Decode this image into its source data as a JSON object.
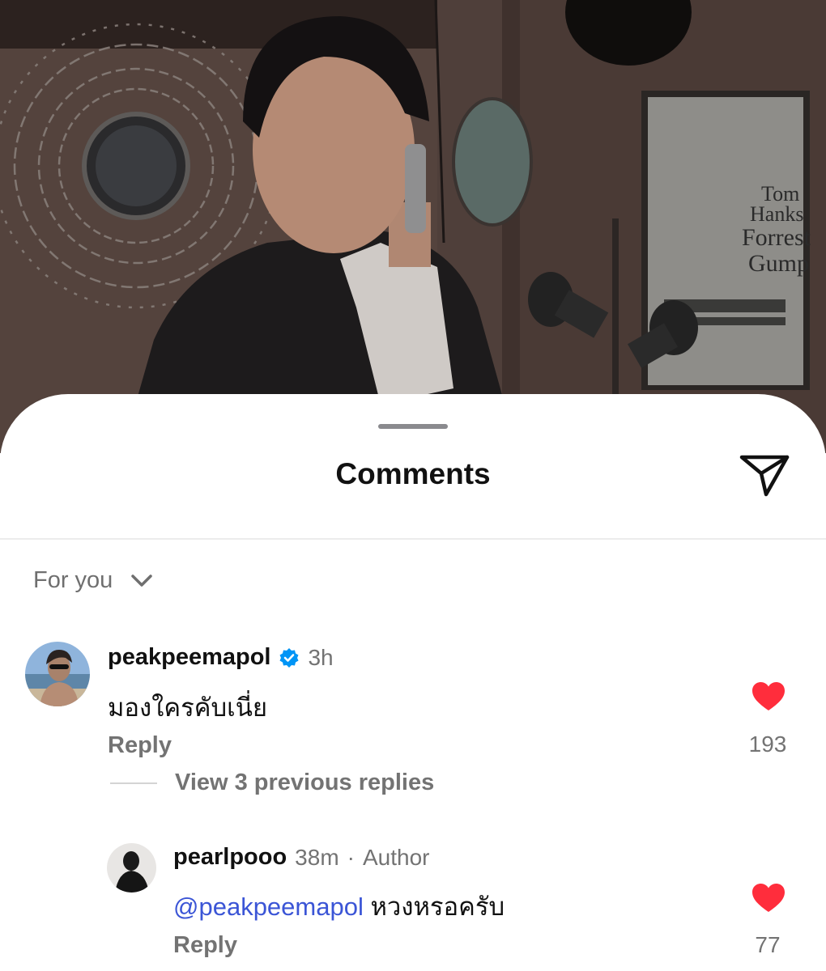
{
  "sheet": {
    "title": "Comments",
    "sort_label": "For you"
  },
  "comments": [
    {
      "username": "peakpeemapol",
      "verified": true,
      "time": "3h",
      "text": "มองใครคับเนี่ย",
      "reply_label": "Reply",
      "likes": "193",
      "liked": true,
      "view_replies_label": "View 3 previous replies",
      "replies": [
        {
          "username": "pearlpooo",
          "time": "38m",
          "separator": "·",
          "badge": "Author",
          "mention": "@peakpeemapol",
          "text": "หวงหรอครับ",
          "reply_label": "Reply",
          "likes": "77",
          "liked": true
        }
      ]
    }
  ],
  "colors": {
    "heart": "#ff2d3c",
    "mention": "#3b55d6",
    "verified": "#0095f6",
    "secondary_text": "#737373"
  },
  "icons": {
    "share": "paper-plane-icon",
    "sort": "chevron-down-icon",
    "like": "heart-icon",
    "verified": "verified-badge-icon"
  }
}
